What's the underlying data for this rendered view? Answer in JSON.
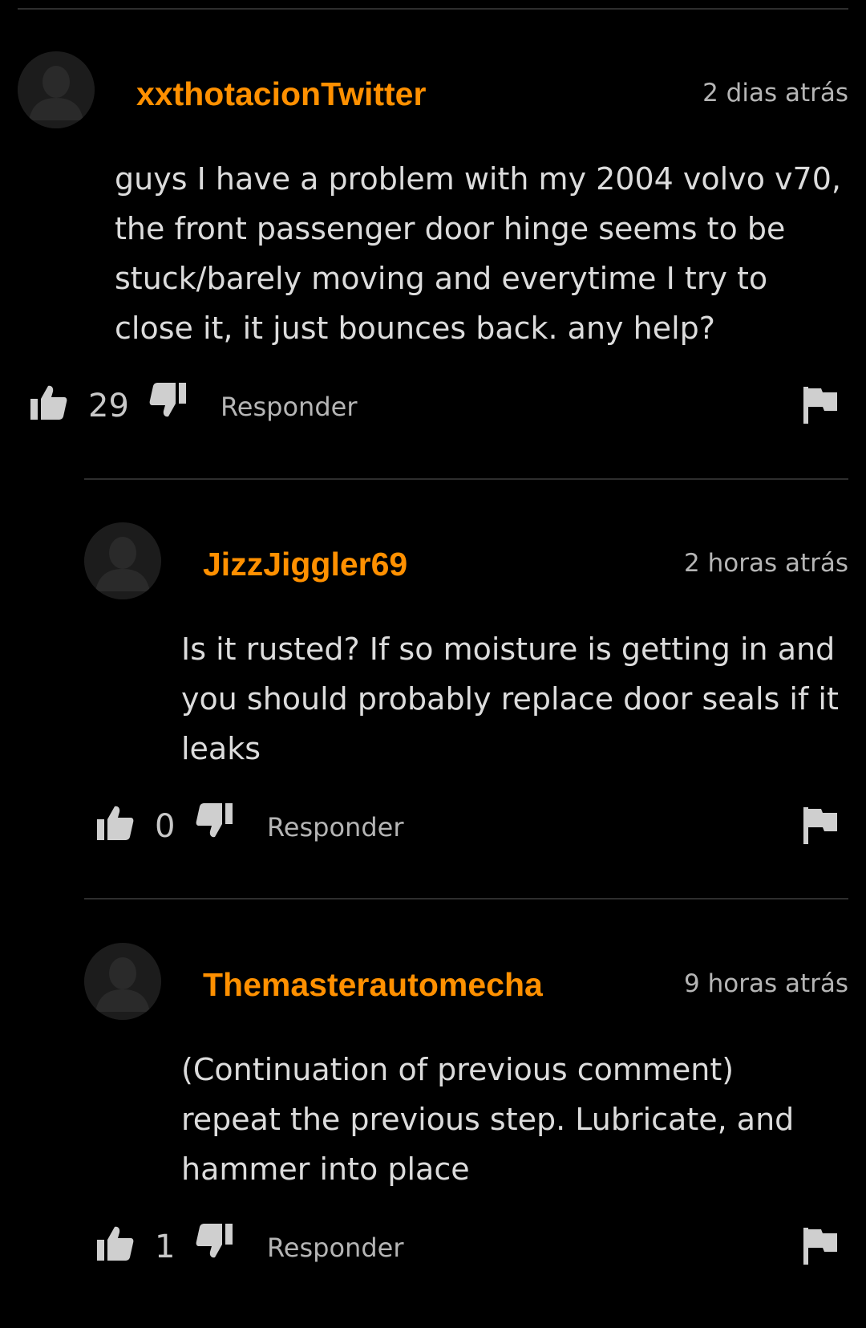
{
  "comments": [
    {
      "username": "xxthotacionTwitter",
      "timestamp": "2 dias atrás",
      "text": "guys I have a problem with my 2004 volvo v70, the front passenger door hinge seems to be stuck/barely moving and everytime I try to close it, it just bounces back. any help?",
      "likes": "29",
      "reply_label": "Responder"
    },
    {
      "username": "JizzJiggler69",
      "timestamp": "2 horas atrás",
      "text": "Is it rusted? If so moisture is getting in and you should probably replace door seals if it leaks",
      "likes": "0",
      "reply_label": "Responder"
    },
    {
      "username": "Themasterautomecha",
      "timestamp": "9 horas atrás",
      "text": "(Continuation of previous comment) repeat the previous step. Lubricate, and hammer into place",
      "likes": "1",
      "reply_label": "Responder"
    }
  ],
  "colors": {
    "background": "#000000",
    "username": "#ff9000",
    "text": "#dcdcdc",
    "muted": "#b5b5b5",
    "icon": "#cfcfcf"
  },
  "icons": [
    "avatar-placeholder-icon",
    "thumbs-up-icon",
    "thumbs-down-icon",
    "flag-icon"
  ]
}
